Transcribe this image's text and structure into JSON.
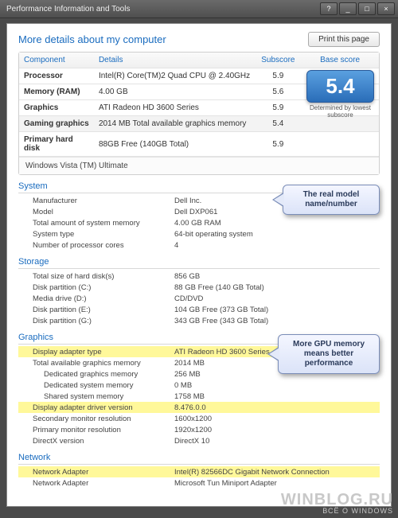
{
  "titlebar": "Performance Information and Tools",
  "header": {
    "title": "More details about my computer",
    "print_label": "Print this page"
  },
  "score": {
    "headers": {
      "component": "Component",
      "details": "Details",
      "subscore": "Subscore",
      "basescore": "Base score"
    },
    "rows": [
      {
        "component": "Processor",
        "details": "Intel(R) Core(TM)2 Quad CPU @ 2.40GHz",
        "subscore": "5.9"
      },
      {
        "component": "Memory (RAM)",
        "details": "4.00 GB",
        "subscore": "5.6"
      },
      {
        "component": "Graphics",
        "details": "ATI Radeon HD 3600 Series",
        "subscore": "5.9"
      },
      {
        "component": "Gaming graphics",
        "details": "2014 MB Total available graphics memory",
        "subscore": "5.4"
      },
      {
        "component": "Primary hard disk",
        "details": "88GB Free (140GB Total)",
        "subscore": "5.9"
      }
    ],
    "base_value": "5.4",
    "base_caption": "Determined by lowest subscore",
    "os": "Windows Vista (TM) Ultimate"
  },
  "system": {
    "title": "System",
    "rows": [
      {
        "k": "Manufacturer",
        "v": "Dell Inc."
      },
      {
        "k": "Model",
        "v": "Dell DXP061"
      },
      {
        "k": "Total amount of system memory",
        "v": "4.00 GB RAM"
      },
      {
        "k": "System type",
        "v": "64-bit operating system"
      },
      {
        "k": "Number of processor cores",
        "v": "4"
      }
    ]
  },
  "storage": {
    "title": "Storage",
    "rows": [
      {
        "k": "Total size of hard disk(s)",
        "v": "856 GB"
      },
      {
        "k": "Disk partition (C:)",
        "v": "88 GB Free (140 GB Total)"
      },
      {
        "k": "Media drive (D:)",
        "v": "CD/DVD"
      },
      {
        "k": "Disk partition (E:)",
        "v": "104 GB Free (373 GB Total)"
      },
      {
        "k": "Disk partition (G:)",
        "v": "343 GB Free (343 GB Total)"
      }
    ]
  },
  "graphics": {
    "title": "Graphics",
    "rows": [
      {
        "k": "Display adapter type",
        "v": "ATI Radeon HD 3600 Series",
        "hl": true
      },
      {
        "k": "Total available graphics memory",
        "v": "2014 MB"
      },
      {
        "k": "Dedicated graphics memory",
        "v": "256 MB",
        "sub": true
      },
      {
        "k": "Dedicated system memory",
        "v": "0 MB",
        "sub": true
      },
      {
        "k": "Shared system memory",
        "v": "1758 MB",
        "sub": true
      },
      {
        "k": "Display adapter driver version",
        "v": "8.476.0.0",
        "hl": true
      },
      {
        "k": "Secondary monitor resolution",
        "v": "1600x1200"
      },
      {
        "k": "Primary monitor resolution",
        "v": "1920x1200"
      },
      {
        "k": "DirectX version",
        "v": "DirectX 10"
      }
    ]
  },
  "network": {
    "title": "Network",
    "rows": [
      {
        "k": "Network Adapter",
        "v": "Intel(R) 82566DC Gigabit Network Connection",
        "hl": true
      },
      {
        "k": "Network Adapter",
        "v": "Microsoft Tun Miniport Adapter"
      }
    ]
  },
  "callouts": {
    "c1": "The real model name/number",
    "c2": "More GPU memory means better performance"
  },
  "watermark": {
    "line1": "WINBLOG.RU",
    "line2": "ВСЁ О WINDOWS"
  }
}
